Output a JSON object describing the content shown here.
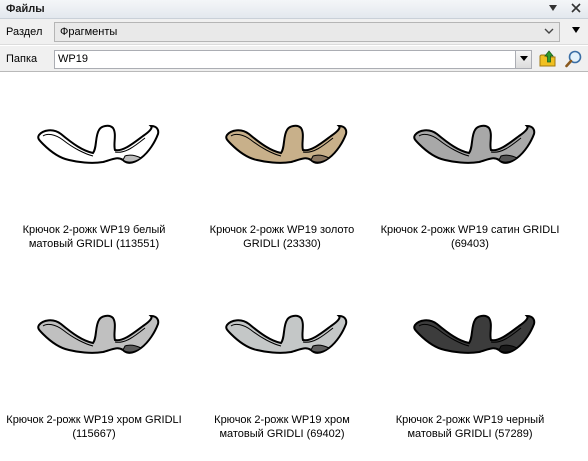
{
  "window": {
    "title": "Файлы",
    "pin_glyph": "▾ (pin)",
    "close_glyph": "×"
  },
  "section_row": {
    "label": "Раздел",
    "value": "Фрагменты",
    "dropdown_icon": "chevron-down-icon"
  },
  "menu_arrow_icon": "triangle-down-icon",
  "folder_row": {
    "label": "Папка",
    "value": "WP19",
    "dropdown_icon": "dropdown-arrow-icon",
    "up_button_icon": "folder-up-icon",
    "search_button_icon": "magnifier-icon"
  },
  "colors": {
    "accent_up": "#2e9c2e",
    "folder_yellow": "#f0c020"
  },
  "items": [
    {
      "caption_line1": "Крючок 2-рожк WP19 белый",
      "caption_line2": "матовый GRIDLI (113551)",
      "fill": "#ffffff",
      "shade": "#bdbdbd"
    },
    {
      "caption_line1": "Крючок 2-рожк WP19 золото",
      "caption_line2": "GRIDLI (23330)",
      "fill": "#c8b08a",
      "shade": "#8a7660"
    },
    {
      "caption_line1": "Крючок 2-рожк WP19 сатин GRIDLI",
      "caption_line2": "(69403)",
      "fill": "#a8a8a8",
      "shade": "#555555"
    },
    {
      "caption_line1": "Крючок 2-рожк WP19 хром GRIDLI",
      "caption_line2": "(115667)",
      "fill": "#c0c0c0",
      "shade": "#5a5a5a"
    },
    {
      "caption_line1": "Крючок 2-рожк WP19 хром",
      "caption_line2": "матовый GRIDLI (69402)",
      "fill": "#c4c7c7",
      "shade": "#5e5e5e"
    },
    {
      "caption_line1": "Крючок 2-рожк WP19 черный",
      "caption_line2": "матовый GRIDLI (57289)",
      "fill": "#3c3c3c",
      "shade": "#1a1a1a"
    }
  ]
}
